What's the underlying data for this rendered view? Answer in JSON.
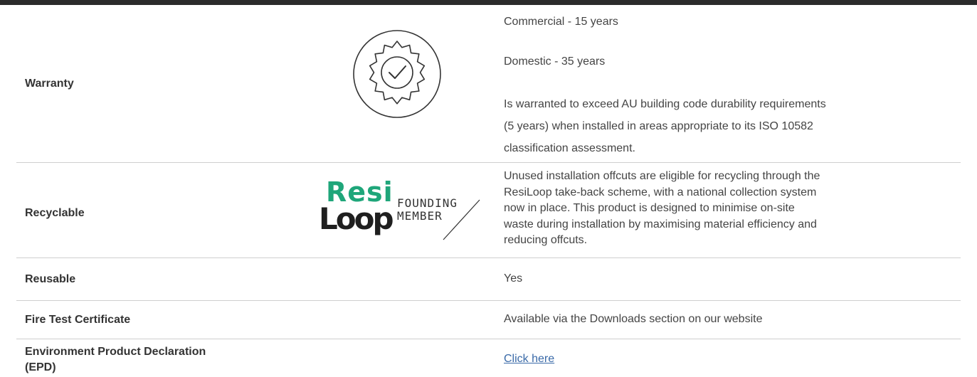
{
  "rows": {
    "warranty": {
      "label": "Warranty",
      "commercial": "Commercial - 15 years",
      "domestic": "Domestic - 35 years",
      "note_1": "Is warranted to exceed AU building code durability requirements",
      "note_2": "(5 years) when installed in areas appropriate to its ISO 10582",
      "note_3": "classification assessment."
    },
    "recyclable": {
      "label": "Recyclable",
      "logo_word_1": "Resi",
      "logo_word_2": "Loop",
      "logo_caption_1": "FOUNDING",
      "logo_caption_2": "MEMBER",
      "text_1": "Unused installation offcuts are eligible for recycling through the",
      "text_2": "ResiLoop take-back scheme, with a national collection system",
      "text_3": "now in place. This product is designed to minimise on-site",
      "text_4": "waste during installation by maximising material efficiency and",
      "text_5": "reducing offcuts."
    },
    "reusable": {
      "label": "Reusable",
      "value": "Yes"
    },
    "fire": {
      "label": "Fire Test Certificate",
      "value": "Available via the Downloads section on our website"
    },
    "epd": {
      "label_1": "Environment Product Declaration",
      "label_2": "(EPD)",
      "link": "Click here"
    }
  },
  "colors": {
    "brand_green": "#1fa67a",
    "text": "#333333",
    "link": "#3a6aa8",
    "divider": "#cfcfcf"
  },
  "icons": {
    "warranty_badge": "check-seal-icon",
    "separator": "diagonal-line-icon"
  }
}
